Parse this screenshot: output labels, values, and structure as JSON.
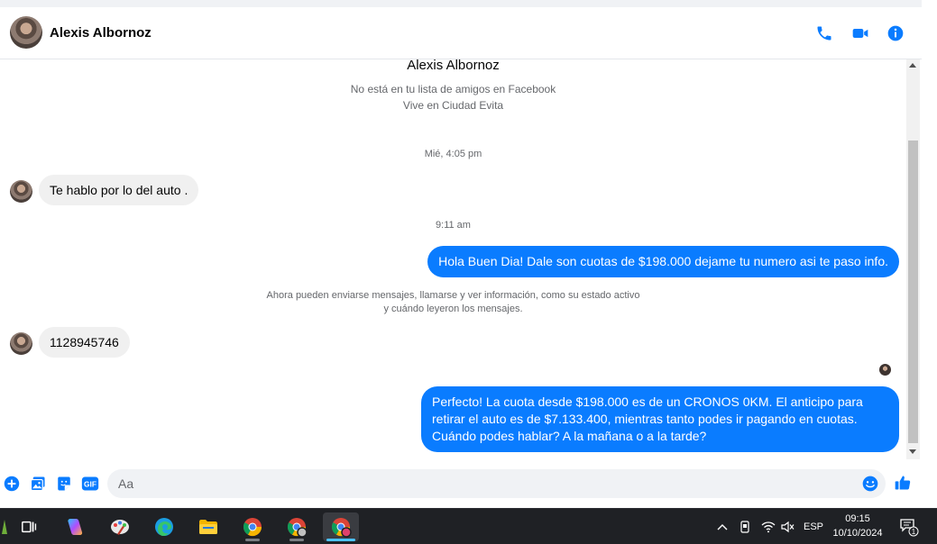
{
  "header": {
    "contact_name": "Alexis Albornoz",
    "icons": [
      "phone-icon",
      "video-camera-icon",
      "info-icon"
    ],
    "accent_color": "#0a7cff"
  },
  "profile": {
    "name": "Alexis Albornoz",
    "line1": "No está en tu lista de amigos en Facebook",
    "line2": "Vive en Ciudad Evita"
  },
  "messages": [
    {
      "type": "timestamp",
      "text": "Mié, 4:05 pm"
    },
    {
      "type": "incoming",
      "text": "Te hablo por lo del auto ."
    },
    {
      "type": "timestamp",
      "text": "9:11 am"
    },
    {
      "type": "outgoing",
      "text": "Hola Buen Dia! Dale son cuotas de $198.000 dejame tu numero asi te paso info."
    },
    {
      "type": "notice",
      "text_line1": "Ahora pueden enviarse mensajes, llamarse y ver información, como su estado activo",
      "text_line2": "y cuándo leyeron los mensajes."
    },
    {
      "type": "incoming",
      "text": "1128945746"
    },
    {
      "type": "outgoing",
      "text": "Perfecto! La cuota desde $198.000 es de un CRONOS 0KM. El anticipo para retirar el auto es de $7.133.400, mientras tanto podes ir pagando en cuotas. Cuándo podes hablar? A la mañana o a la tarde?"
    }
  ],
  "composer": {
    "placeholder": "Aa",
    "icons": [
      "plus-icon",
      "photo-icon",
      "sticker-icon",
      "gif-icon",
      "emoji-icon",
      "thumbs-up-icon"
    ],
    "gif_label": "GIF"
  },
  "taskbar": {
    "apps": [
      "task-view-icon",
      "copilot-icon",
      "paint-icon",
      "edge-icon",
      "file-explorer-icon",
      "chrome-icon",
      "chrome-profile-icon",
      "chrome-active-icon"
    ],
    "language": "ESP",
    "time": "09:15",
    "date": "10/10/2024",
    "notification_count": "1"
  }
}
